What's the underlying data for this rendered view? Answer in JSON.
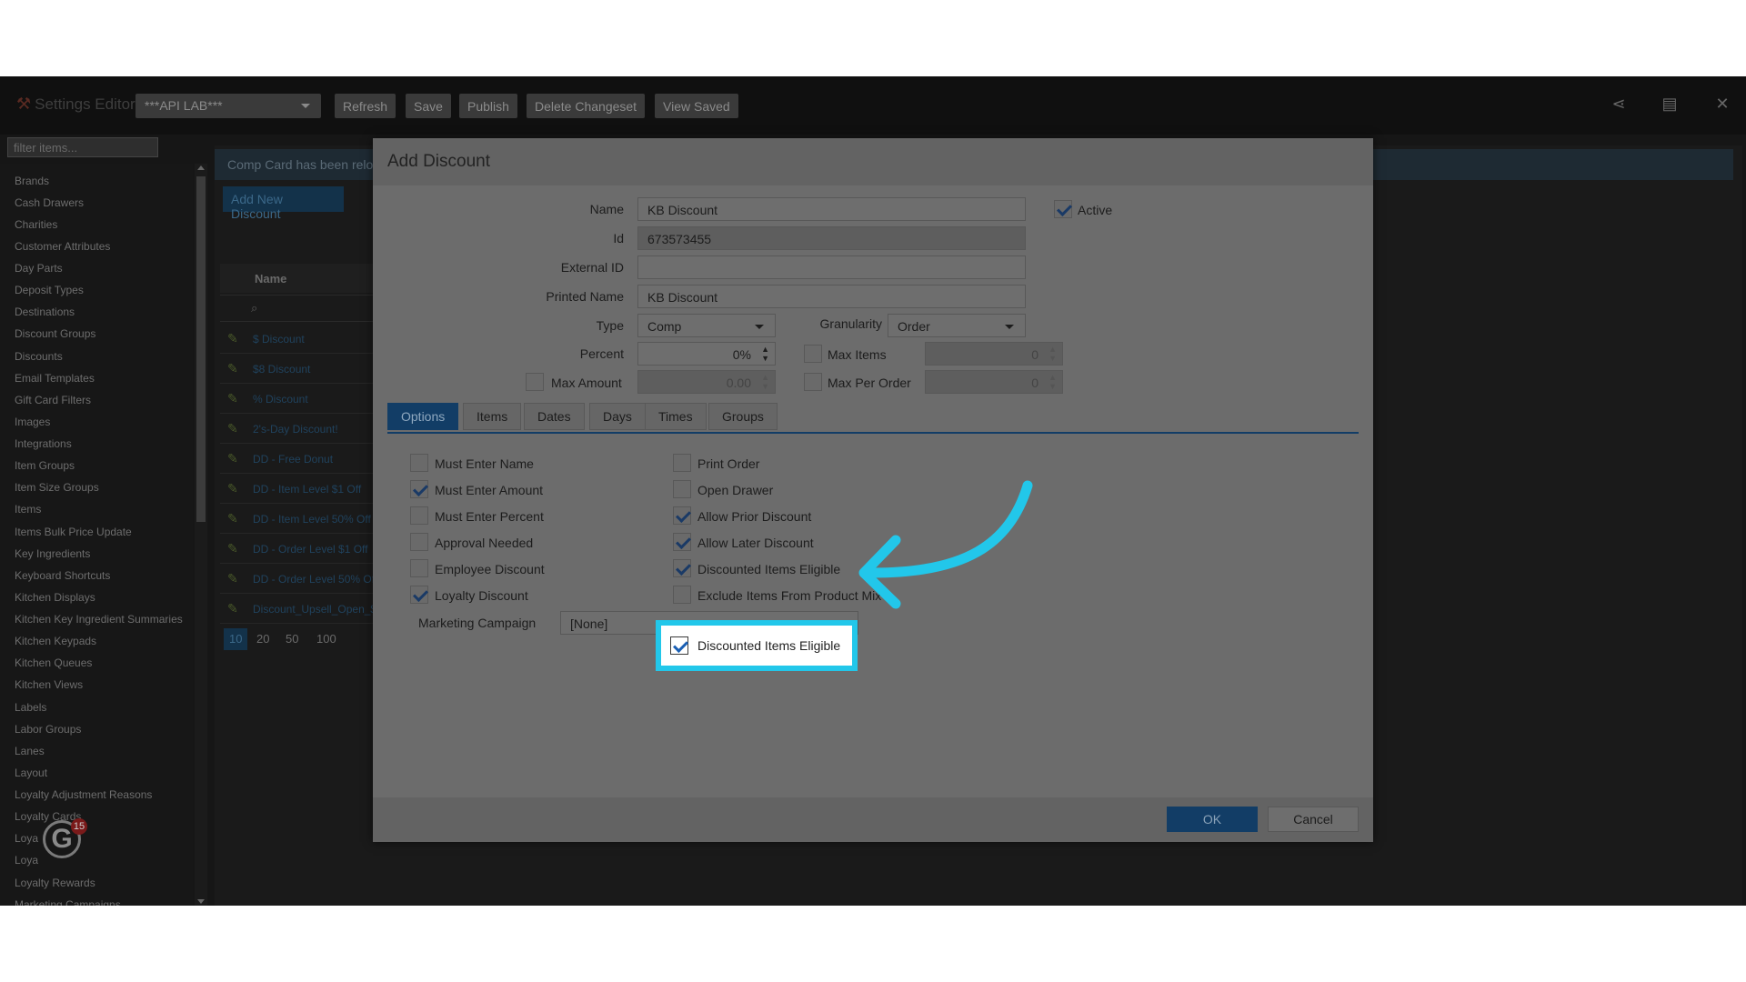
{
  "app": {
    "title": "Settings Editor",
    "environment": "***API LAB***",
    "buttons": [
      "Refresh",
      "Save",
      "Publish",
      "Delete Changeset",
      "View Saved"
    ]
  },
  "sidebar": {
    "filter_placeholder": "filter items...",
    "items": [
      "Brands",
      "Cash Drawers",
      "Charities",
      "Customer Attributes",
      "Day Parts",
      "Deposit Types",
      "Destinations",
      "Discount Groups",
      "Discounts",
      "Email Templates",
      "Gift Card Filters",
      "Images",
      "Integrations",
      "Item Groups",
      "Item Size Groups",
      "Items",
      "Items Bulk Price Update",
      "Key Ingredients",
      "Keyboard Shortcuts",
      "Kitchen Displays",
      "Kitchen Key Ingredient Summaries",
      "Kitchen Keypads",
      "Kitchen Queues",
      "Kitchen Views",
      "Labels",
      "Labor Groups",
      "Lanes",
      "Layout",
      "Loyalty Adjustment Reasons",
      "Loyalty Cards",
      "Loya",
      "Loya",
      "Loyalty Rewards",
      "Marketing Campaigns"
    ],
    "badge_letter": "G",
    "badge_count": "15"
  },
  "list": {
    "notice": "Comp Card has been relo",
    "add_button": "Add New Discount",
    "column_name": "Name",
    "rows": [
      "$ Discount",
      "$8 Discount",
      "% Discount",
      "2's-Day Discount!",
      "DD - Free Donut",
      "DD - Item Level $1 Off",
      "DD - Item Level 50% Off",
      "DD - Order Level $1 Off",
      "DD - Order Level 50% Of",
      "Discount_Upsell_Open_$"
    ],
    "pages": [
      "10",
      "20",
      "50",
      "100"
    ]
  },
  "modal": {
    "title": "Add Discount",
    "name_label": "Name",
    "name_value": "KB Discount",
    "active_label": "Active",
    "active": true,
    "id_label": "Id",
    "id_value": "673573455",
    "external_id_label": "External ID",
    "external_id_value": "",
    "printed_name_label": "Printed Name",
    "printed_name_value": "KB Discount",
    "type_label": "Type",
    "type_value": "Comp",
    "granularity_label": "Granularity",
    "granularity_value": "Order",
    "percent_label": "Percent",
    "percent_value": "0%",
    "max_items_label": "Max Items",
    "max_items_value": "0",
    "max_amount_label": "Max Amount",
    "max_amount_value": "0.00",
    "max_per_order_label": "Max Per Order",
    "max_per_order_value": "0",
    "tabs": [
      "Options",
      "Items",
      "Dates",
      "Days",
      "Times",
      "Groups"
    ],
    "options_left": [
      {
        "label": "Must Enter Name",
        "checked": false
      },
      {
        "label": "Must Enter Amount",
        "checked": true
      },
      {
        "label": "Must Enter Percent",
        "checked": false
      },
      {
        "label": "Approval Needed",
        "checked": false
      },
      {
        "label": "Employee Discount",
        "checked": false
      },
      {
        "label": "Loyalty Discount",
        "checked": true
      }
    ],
    "options_right": [
      {
        "label": "Print Order",
        "checked": false
      },
      {
        "label": "Open Drawer",
        "checked": false
      },
      {
        "label": "Allow Prior Discount",
        "checked": true
      },
      {
        "label": "Allow Later Discount",
        "checked": true
      },
      {
        "label": "Discounted Items Eligible",
        "checked": true
      },
      {
        "label": "Exclude Items From Product Mix",
        "checked": false
      }
    ],
    "marketing_label": "Marketing Campaign",
    "marketing_value": "[None]",
    "ok": "OK",
    "cancel": "Cancel"
  },
  "highlight": {
    "label": "Discounted Items Eligible",
    "color": "#22c7ea"
  }
}
